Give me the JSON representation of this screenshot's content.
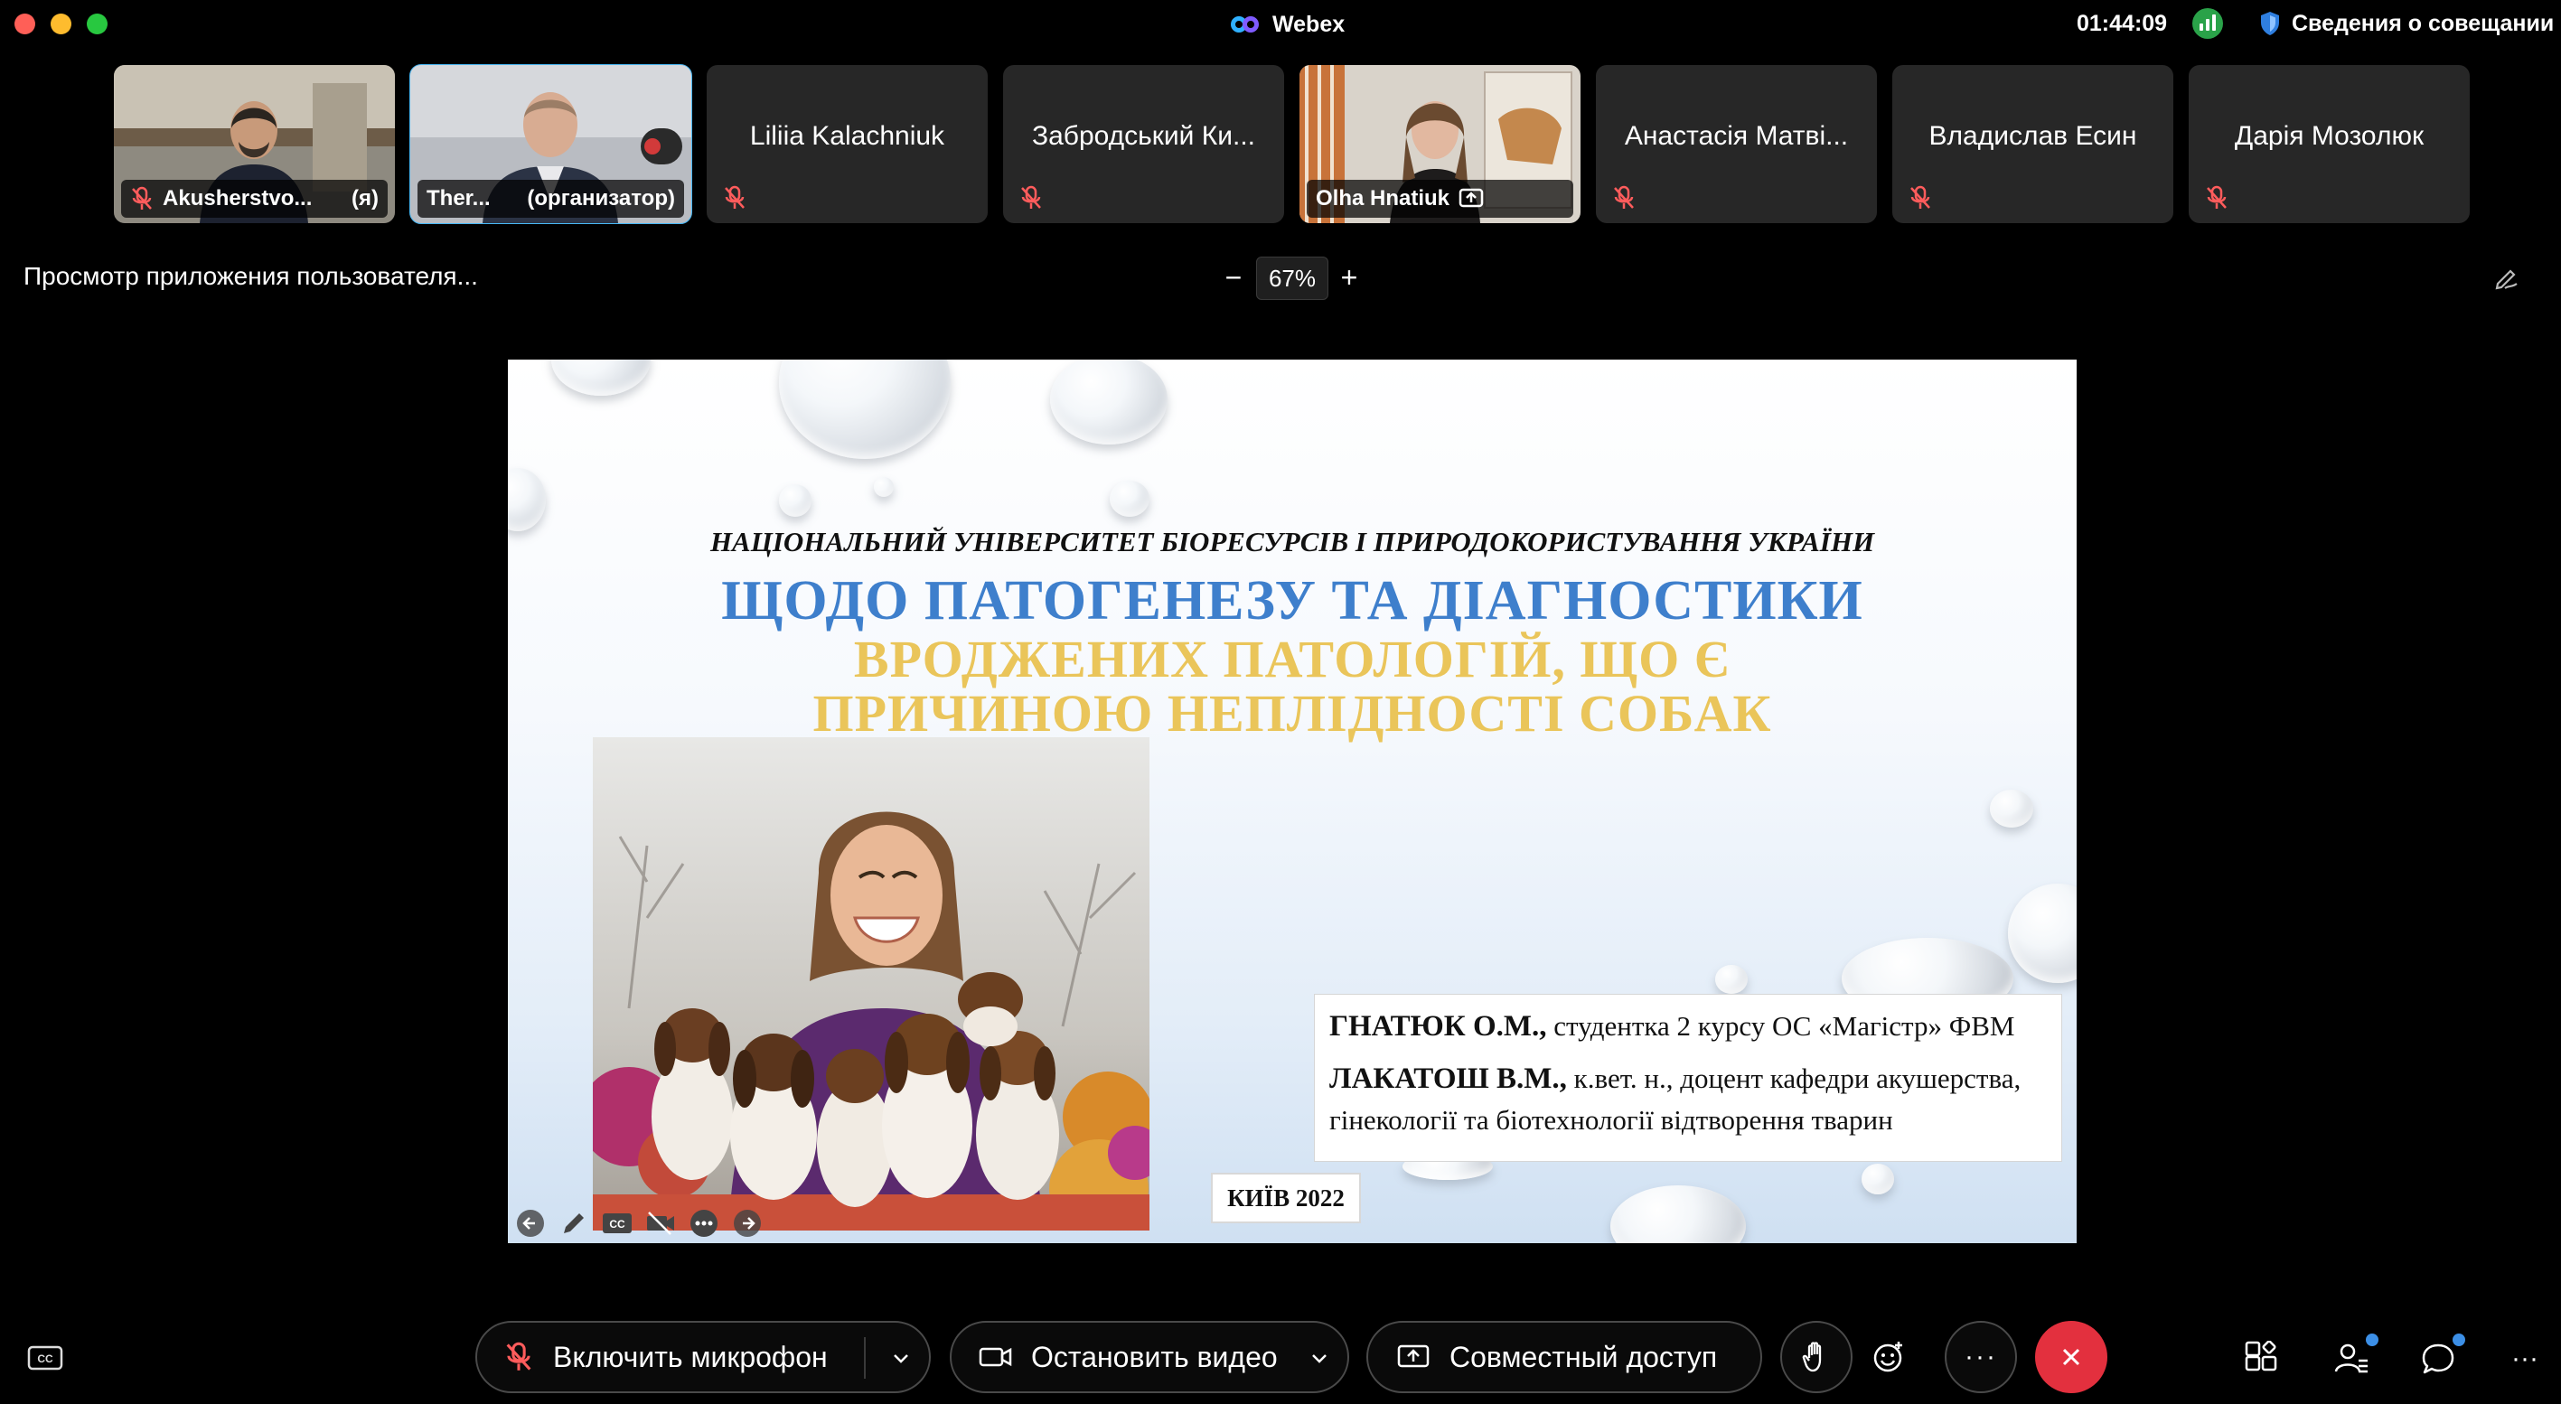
{
  "titlebar": {
    "app_name": "Webex",
    "clock": "01:44:09",
    "meeting_info_label": "Сведения о совещании"
  },
  "participants": [
    {
      "name": "Akusherstvo...",
      "suffix": "(я)",
      "video": true,
      "muted": true
    },
    {
      "name": "Ther...",
      "suffix": "(организатор)",
      "video": true,
      "muted": false,
      "active": true
    },
    {
      "name": "Liliia Kalachniuk",
      "video": false,
      "muted": true
    },
    {
      "name": "Забродський Ки...",
      "video": false,
      "muted": true
    },
    {
      "name": "Olha Hnatiuk",
      "video": true,
      "muted": false,
      "sharing": true
    },
    {
      "name": "Анастасія Матві...",
      "video": false,
      "muted": true
    },
    {
      "name": "Владислав Есин",
      "video": false,
      "muted": true
    },
    {
      "name": "Дарія Мозолюк",
      "video": false,
      "muted": true
    }
  ],
  "share": {
    "label": "Просмотр приложения пользователя...",
    "zoom_value": "67%",
    "zoom_minus": "−",
    "zoom_plus": "+"
  },
  "slide": {
    "university": "НАЦІОНАЛЬНИЙ УНІВЕРСИТЕТ БІОРЕСУРСІВ І ПРИРОДОКОРИСТУВАННЯ УКРАЇНИ",
    "title_line1": "ЩОДО ПАТОГЕНЕЗУ ТА ДІАГНОСТИКИ",
    "title_line2": "ВРОДЖЕНИХ ПАТОЛОГІЙ, ЩО Є",
    "title_line3": "ПРИЧИНОЮ НЕПЛІДНОСТІ СОБАК",
    "author1_name": "ГНАТЮК О.М.,",
    "author1_role": " студентка 2 курсу ОС «Магістр» ФВМ",
    "author2_name": "ЛАКАТОШ В.М.,",
    "author2_role": " к.вет. н., доцент кафедри акушерства, гінекології та біотехнології відтворення тварин",
    "city_year": "КИЇВ 2022"
  },
  "controls": {
    "mic_label": "Включить микрофон",
    "video_label": "Остановить видео",
    "share_label": "Совместный доступ",
    "more_label": "···",
    "right_more": "···"
  },
  "colors": {
    "accent_blue": "#48b8f5",
    "leave_red": "#e3303e",
    "title_blue": "#3e7fcc",
    "title_gold": "#eac55a"
  }
}
